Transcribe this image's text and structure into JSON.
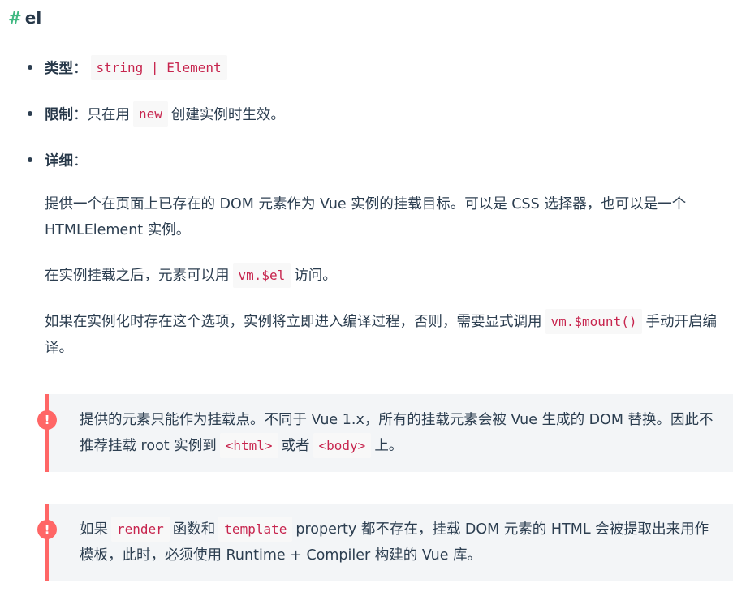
{
  "heading": {
    "hash": "#",
    "title": "el"
  },
  "items": {
    "type": {
      "label": "类型",
      "sep": "：",
      "code": "string | Element"
    },
    "limit": {
      "label": "限制",
      "sep": "：",
      "pre": "只在用",
      "code": "new",
      "post": "创建实例时生效。"
    },
    "detail": {
      "label": "详细",
      "sep": "："
    }
  },
  "para1": "提供一个在页面上已存在的 DOM 元素作为 Vue 实例的挂载目标。可以是 CSS 选择器，也可以是一个 HTMLElement 实例。",
  "para2": {
    "pre": "在实例挂载之后，元素可以用",
    "code": "vm.$el",
    "post": "访问。"
  },
  "para3": {
    "pre": "如果在实例化时存在这个选项，实例将立即进入编译过程，否则，需要显式调用",
    "code": "vm.$mount()",
    "post": "手动开启编译。"
  },
  "tip1": {
    "icon": "!",
    "text_a": "提供的元素只能作为挂载点。不同于 Vue 1.x，所有的挂载元素会被 Vue 生成的 DOM 替换。因此不推荐挂载 root 实例到",
    "code_a": "<html>",
    "mid": "或者",
    "code_b": "<body>",
    "end": "上。"
  },
  "tip2": {
    "icon": "!",
    "pre": "如果",
    "code_a": "render",
    "mid": "函数和",
    "code_b": "template",
    "post": "property 都不存在，挂载 DOM 元素的 HTML 会被提取出来用作模板，此时，必须使用 Runtime + Compiler 构建的 Vue 库。"
  }
}
